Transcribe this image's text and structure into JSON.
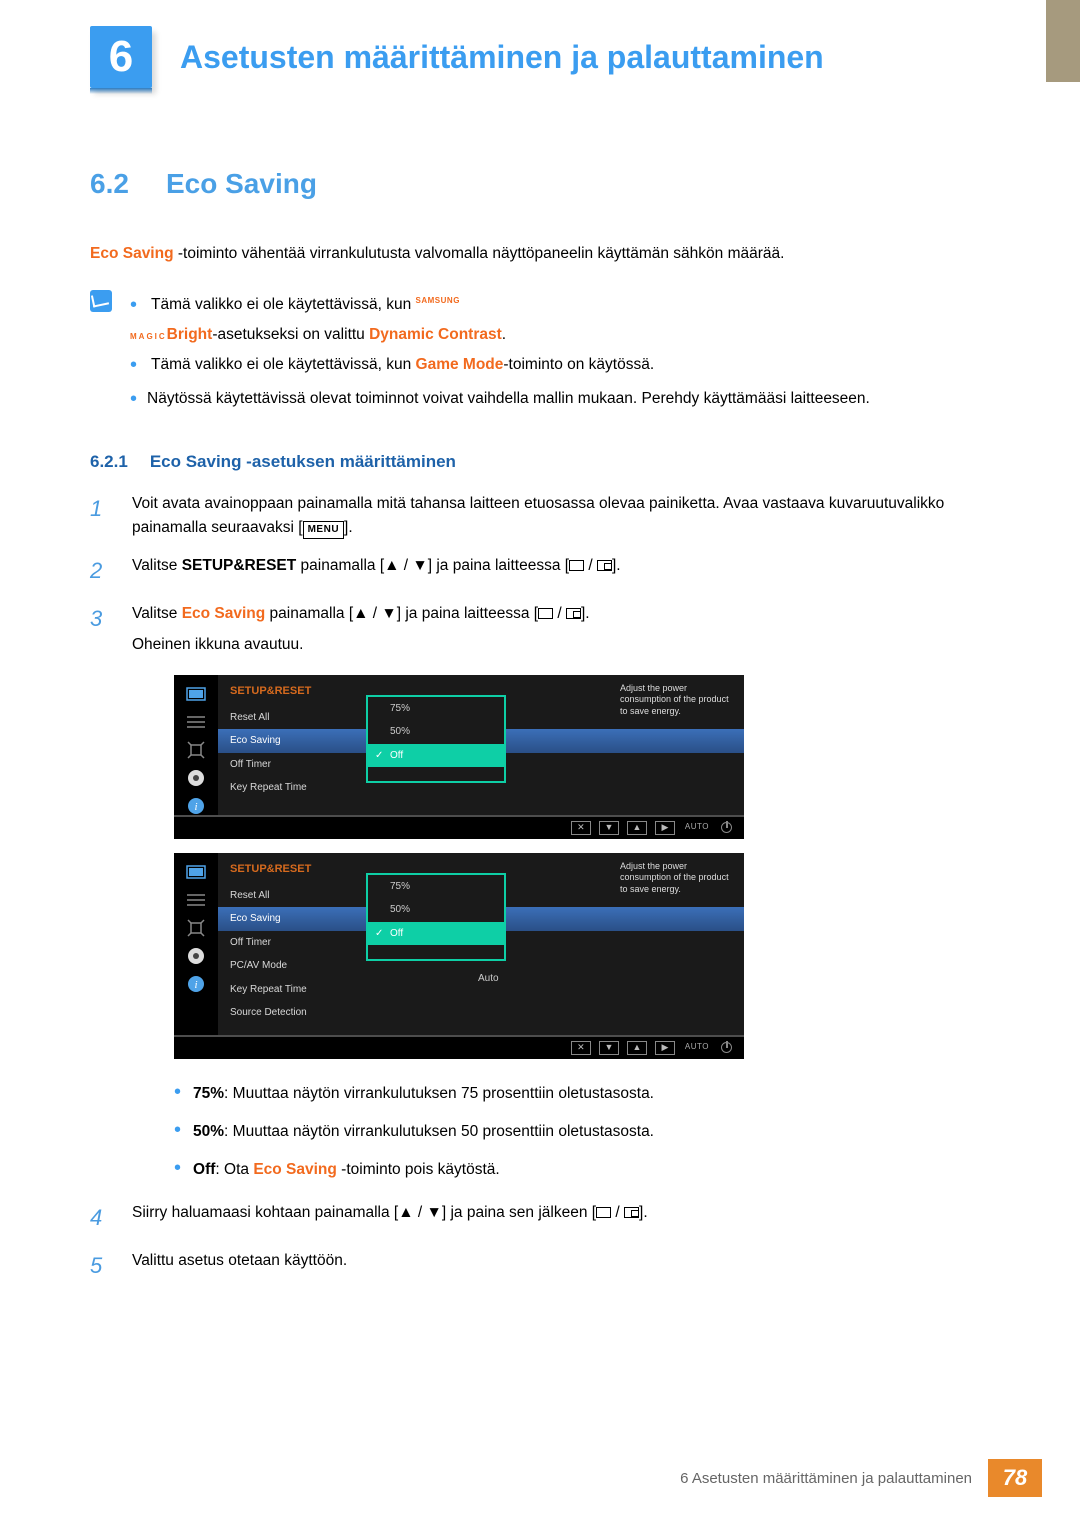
{
  "chapter": {
    "number": "6",
    "title": "Asetusten määrittäminen ja palauttaminen"
  },
  "section": {
    "number": "6.2",
    "title": "Eco Saving"
  },
  "intro": {
    "bold": "Eco Saving",
    "text": " -toiminto vähentää virrankulutusta valvomalla näyttöpaneelin käyttämän sähkön määrää."
  },
  "notes": {
    "b1a": "Tämä valikko ei ole käytettävissä, kun ",
    "b1brand_small": "SAMSUNG",
    "b1brand_big": "MAGIC",
    "b1bright": "Bright",
    "b1b": "-asetukseksi on valittu ",
    "b1dc": "Dynamic Contrast",
    "b1c": ".",
    "b2a": "Tämä valikko ei ole käytettävissä, kun ",
    "b2gm": "Game Mode",
    "b2b": "-toiminto on käytössä.",
    "b3": "Näytössä käytettävissä olevat toiminnot voivat vaihdella mallin mukaan. Perehdy käyttämääsi laitteeseen."
  },
  "subsection": {
    "number": "6.2.1",
    "title": "Eco Saving -asetuksen määrittäminen"
  },
  "steps": {
    "s1": "Voit avata avainoppaan painamalla mitä tahansa laitteen etuosassa olevaa painiketta. Avaa vastaava kuvaruutuvalikko painamalla seuraavaksi [",
    "s1menu": "MENU",
    "s1end": "].",
    "s2a": "Valitse ",
    "s2sr": "SETUP&RESET",
    "s2b": " painamalla [",
    "s2c": "] ja paina laitteessa [",
    "s2d": "].",
    "s3a": "Valitse ",
    "s3es": "Eco Saving",
    "s3b": " painamalla [",
    "s3c": "] ja paina laitteessa [",
    "s3d": "].",
    "s3e": "Oheinen ikkuna avautuu.",
    "s4a": "Siirry haluamaasi kohtaan painamalla [",
    "s4b": "] ja paina sen jälkeen [",
    "s4c": "].",
    "s5": "Valittu asetus otetaan käyttöön."
  },
  "osd": {
    "header": "SETUP&RESET",
    "tip": "Adjust the power consumption of the product to save energy.",
    "menu1": [
      "Reset All",
      "Eco Saving",
      "Off Timer",
      "Key Repeat Time"
    ],
    "menu2": [
      "Reset All",
      "Eco Saving",
      "Off Timer",
      "PC/AV Mode",
      "Key Repeat Time",
      "Source Detection"
    ],
    "sourceVal": "Auto",
    "sub": {
      "o1": "75%",
      "o2": "50%",
      "o3": "Off"
    },
    "nav_auto": "AUTO"
  },
  "options": {
    "o1b": "75%",
    "o1t": ": Muuttaa näytön virrankulutuksen 75 prosenttiin oletustasosta.",
    "o2b": "50%",
    "o2t": ": Muuttaa näytön virrankulutuksen 50 prosenttiin oletustasosta.",
    "o3b": "Off",
    "o3c": ": Ota ",
    "o3es": "Eco Saving",
    "o3t": " -toiminto pois käytöstä."
  },
  "footer": {
    "text": "6 Asetusten määrittäminen ja palauttaminen",
    "page": "78"
  }
}
